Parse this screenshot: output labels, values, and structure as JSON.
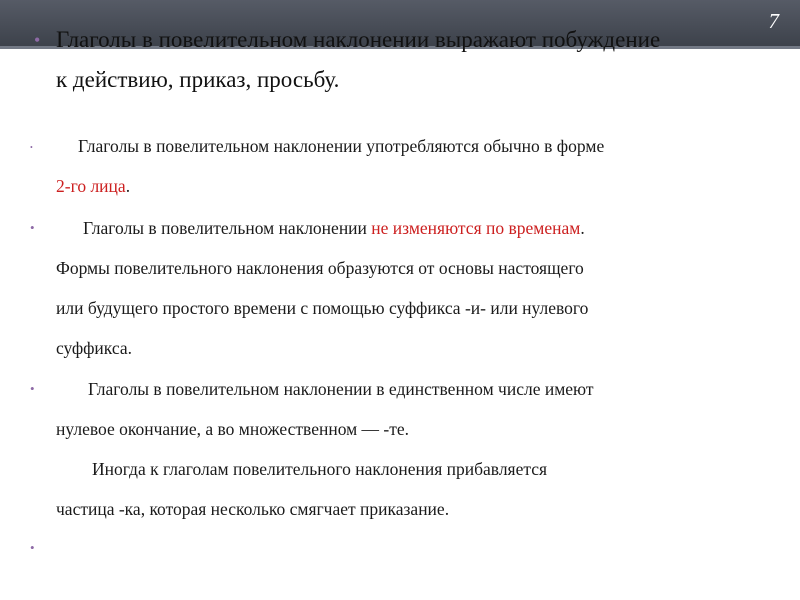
{
  "slide_number": "7",
  "title": {
    "line1": "Глаголы в повелительном наклонении выражают побуждение",
    "line2": "к действию, приказ, просьбу."
  },
  "paragraphs": [
    {
      "line1_text": "Глаголы в повелительном наклонении употребляются обычно в форме",
      "line2_highlight": "2-го лица",
      "line2_end": "."
    },
    {
      "line1_text": "Глаголы в повелительном наклонении ",
      "line1_highlight": "не изменяются по временам",
      "line1_end": ".",
      "line2": "Формы повелительного наклонения образуются от основы настоящего",
      "line3": "или будущего простого времени с помощью суффикса -и- или нулевого",
      "line4": "суффикса."
    },
    {
      "line1": "Глаголы в повелительном наклонении в единственном числе имеют",
      "line2": "нулевое окончание, а во множественном — -те.",
      "line3": "Иногда к глаголам повелительного наклонения прибавляется",
      "line4": "частица -ка, которая несколько смягчает приказание."
    }
  ],
  "colors": {
    "bullet": "#8e6aa6",
    "highlight": "#cc1f1f",
    "banner": "#4a4f58"
  }
}
